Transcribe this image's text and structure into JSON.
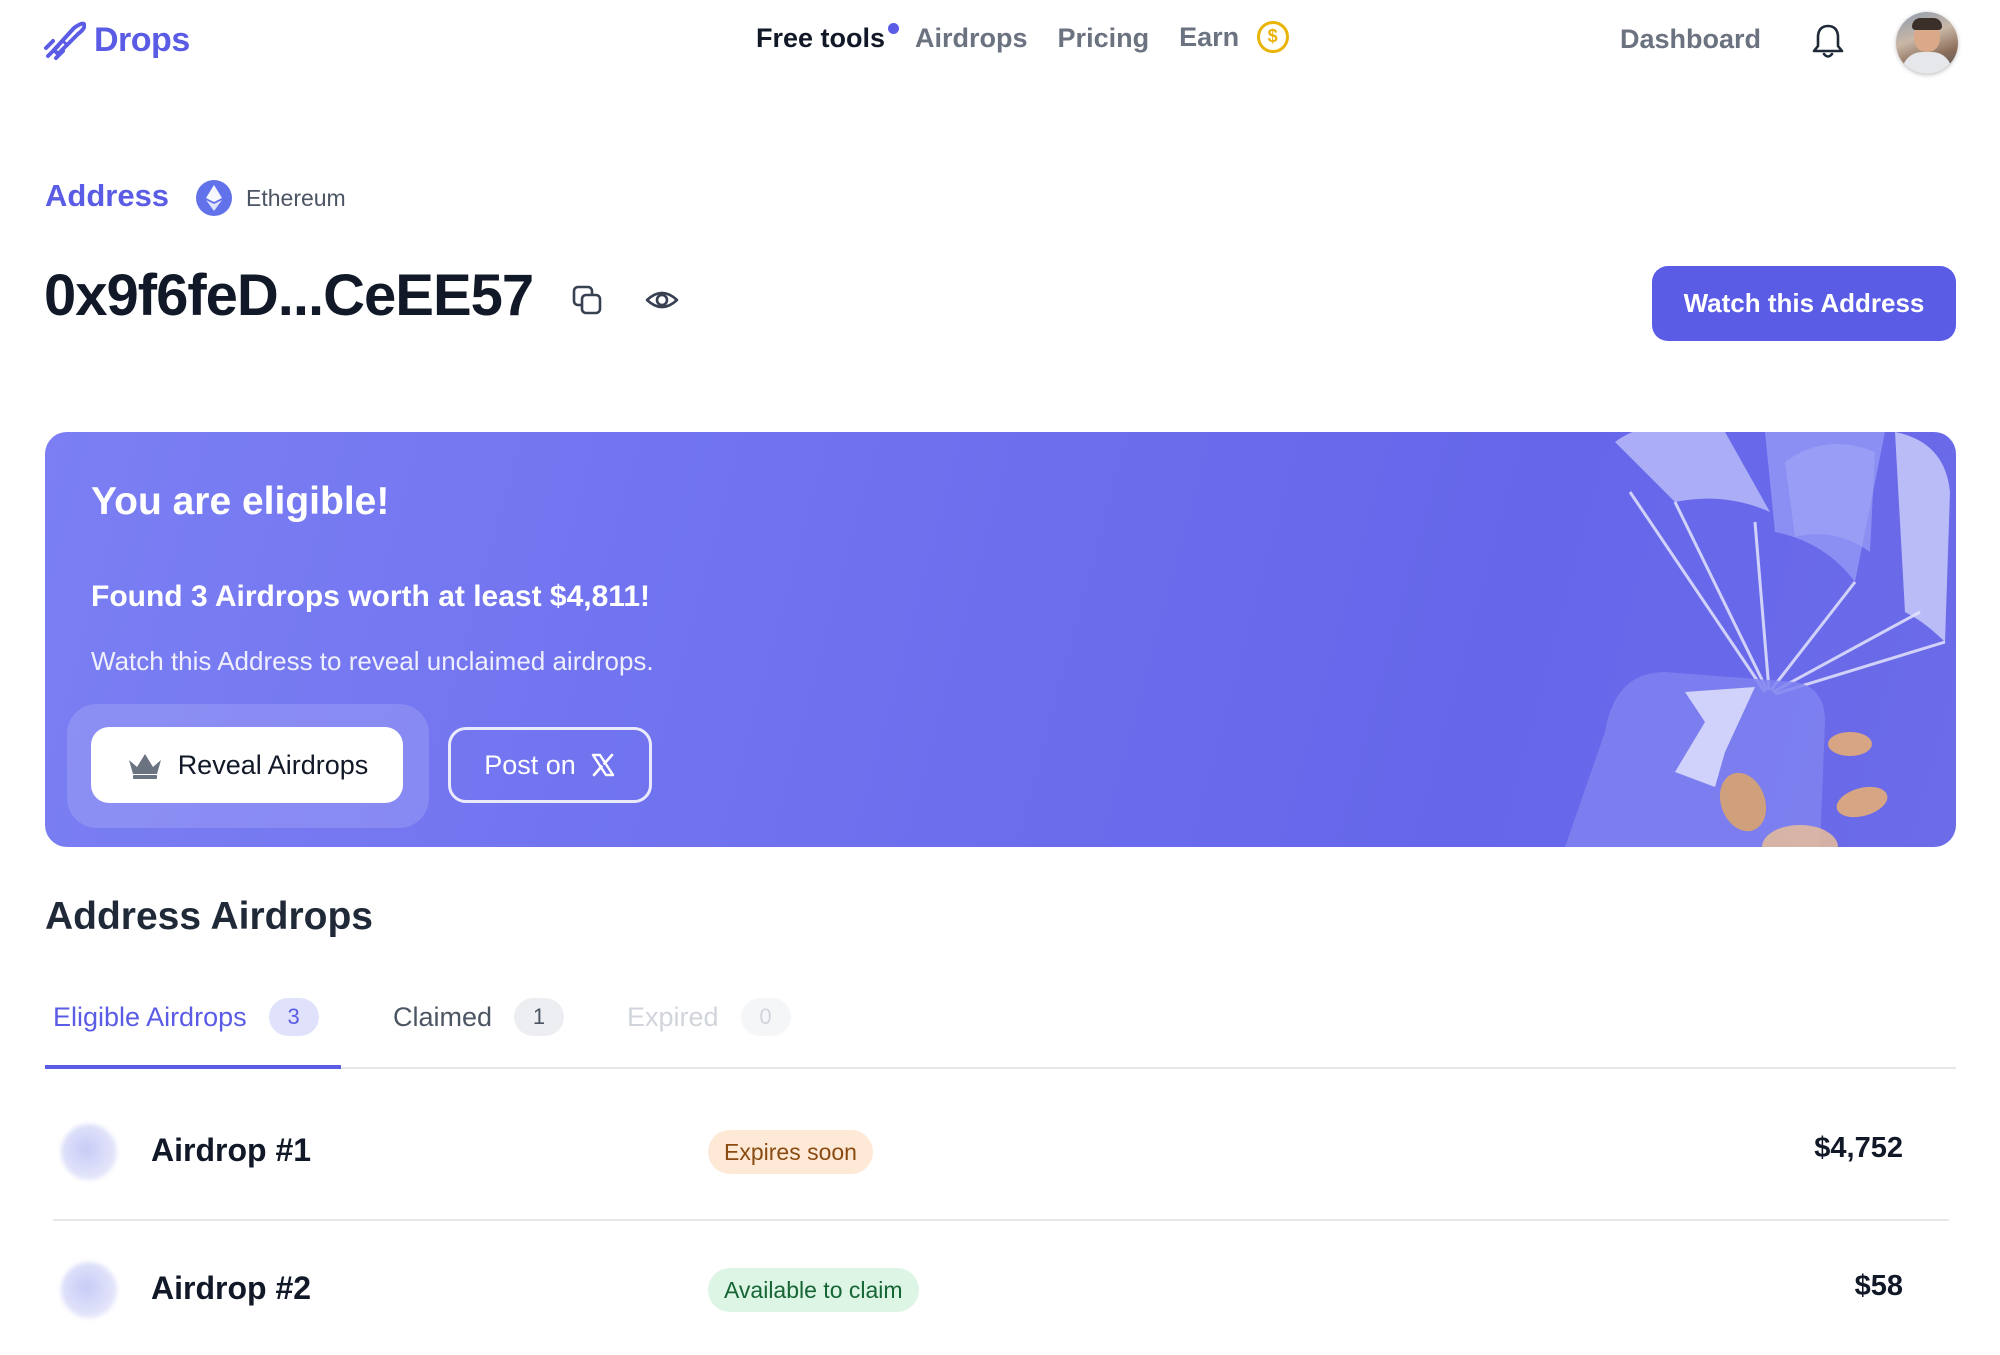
{
  "header": {
    "brand": "Drops",
    "nav": [
      {
        "label": "Free tools",
        "active": true,
        "dot": true
      },
      {
        "label": "Airdrops"
      },
      {
        "label": "Pricing"
      },
      {
        "label": "Earn",
        "icon": "dollar-coin-icon"
      }
    ],
    "earn_coin": "$",
    "dashboard": "Dashboard"
  },
  "address": {
    "label": "Address",
    "chain": "Ethereum",
    "value": "0x9f6feD...CeEE57",
    "watch_button": "Watch this Address"
  },
  "banner": {
    "title": "You are eligible!",
    "found": "Found 3 Airdrops worth at least $4,811!",
    "subtitle": "Watch this Address to reveal unclaimed airdrops.",
    "reveal_button": "Reveal Airdrops",
    "post_button": "Post on"
  },
  "airdrops": {
    "title": "Address Airdrops",
    "tabs": [
      {
        "label": "Eligible Airdrops",
        "count": "3"
      },
      {
        "label": "Claimed",
        "count": "1"
      },
      {
        "label": "Expired",
        "count": "0"
      }
    ],
    "rows": [
      {
        "name": "Airdrop #1",
        "status": "Expires soon",
        "value": "$4,752"
      },
      {
        "name": "Airdrop #2",
        "status": "Available to claim",
        "value": "$58"
      }
    ]
  },
  "colors": {
    "accent": "#5b5ce6",
    "banner": "#6f71ee",
    "expires_badge_bg": "#fde9d6",
    "claim_badge_bg": "#dcf5e5"
  }
}
